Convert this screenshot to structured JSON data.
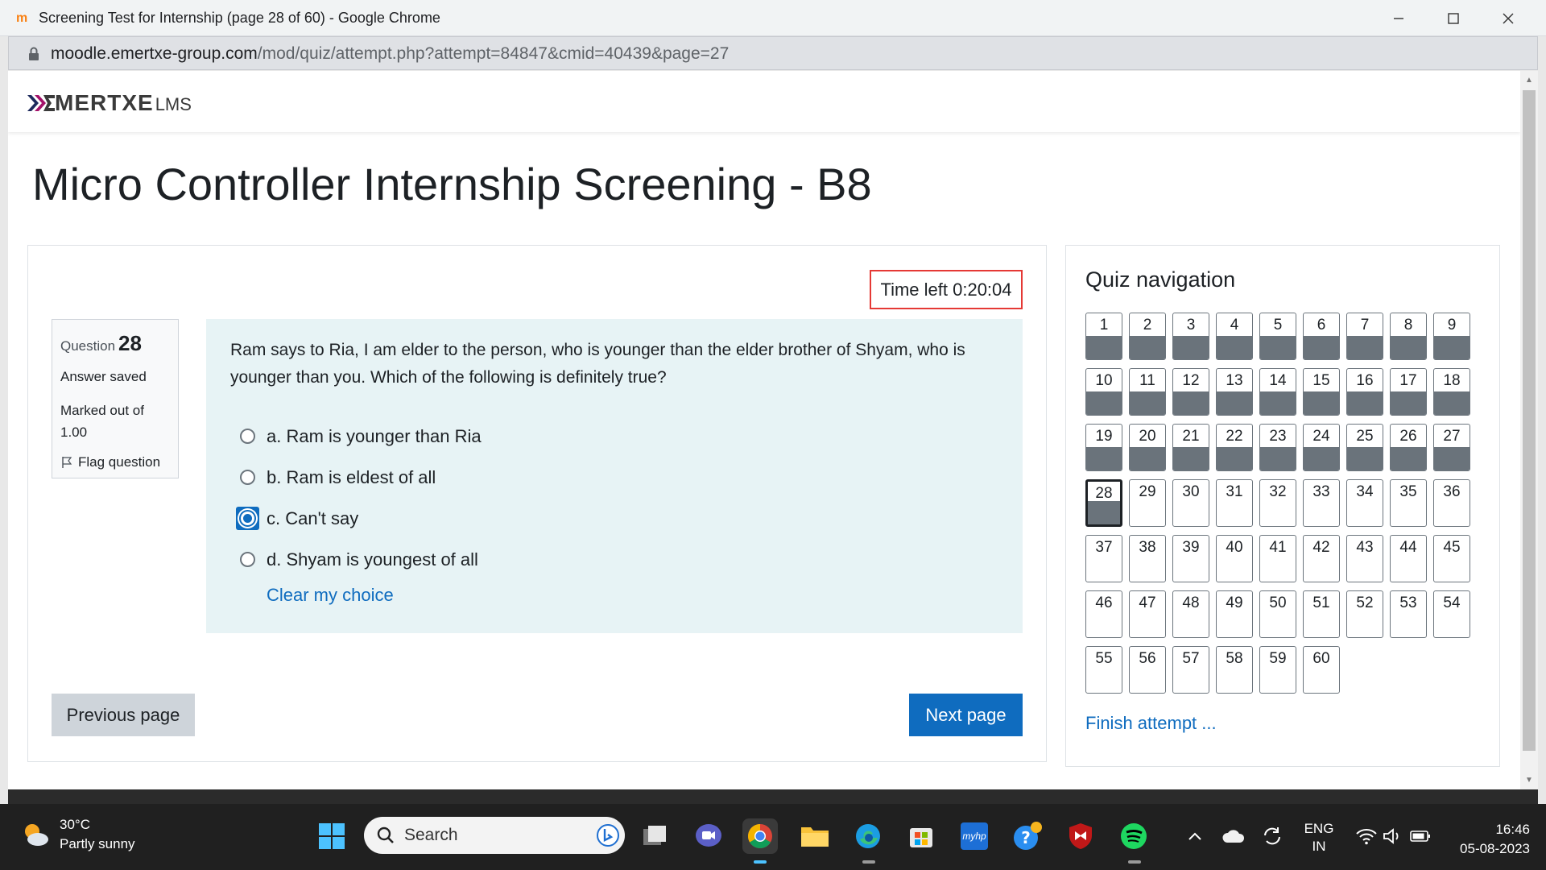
{
  "browser": {
    "tab_title": "Screening Test for Internship (page 28 of 60) - Google Chrome",
    "url_domain": "moodle.emertxe-group.com",
    "url_path": "/mod/quiz/attempt.php?attempt=84847&cmid=40439&page=27"
  },
  "site": {
    "brand": "MERTXE",
    "brand_suffix": "LMS"
  },
  "page": {
    "title": "Micro Controller Internship Screening - B8"
  },
  "timer": {
    "text": "Time left 0:20:04"
  },
  "question_info": {
    "label": "Question",
    "number": "28",
    "state": "Answer saved",
    "marked": "Marked out of 1.00",
    "flag_label": "Flag question"
  },
  "question": {
    "text": "Ram says to Ria, I am elder to the person, who is younger than the elder brother of Shyam, who is younger than you. Which of the following is definitely true?",
    "options": [
      {
        "label": "a. Ram is younger than Ria",
        "selected": false
      },
      {
        "label": "b. Ram is eldest of all",
        "selected": false
      },
      {
        "label": "c. Can't say",
        "selected": true
      },
      {
        "label": "d. Shyam is youngest of all",
        "selected": false
      }
    ],
    "clear_label": "Clear my choice"
  },
  "buttons": {
    "previous": "Previous page",
    "next": "Next page"
  },
  "quiz_nav": {
    "title": "Quiz navigation",
    "current": 28,
    "answered_through": 28,
    "total": 60,
    "finish_label": "Finish attempt ..."
  },
  "taskbar": {
    "temperature": "30°C",
    "weather": "Partly sunny",
    "search_placeholder": "Search",
    "lang_1": "ENG",
    "lang_2": "IN",
    "time": "16:46",
    "date": "05-08-2023",
    "hp_label": "myhp"
  }
}
